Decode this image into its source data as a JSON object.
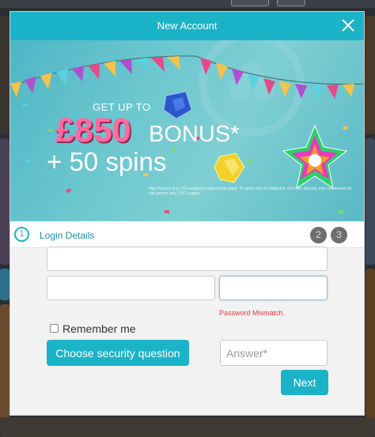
{
  "modal": {
    "title": "New Account",
    "close_icon": "close-icon"
  },
  "banner": {
    "line1": "GET UP TO",
    "amount": "£850",
    "bonus": "BONUS*",
    "spins": "+ 50 spins",
    "small_print": "New Players only. 50x wagering requirement apply. 50 spins only on Starburst. £10 min. deposit, max conversion 4x, slot games only. T&C's apply."
  },
  "steps": {
    "current_number": "1",
    "current_label": "Login Details",
    "step2": "2",
    "step3": "3"
  },
  "form": {
    "field1_value": "",
    "field2_value": "",
    "field3_value": "",
    "error_text": "Password Mismatch.",
    "remember_label": "Remember me",
    "remember_checked": false,
    "security_button": "Choose security question",
    "answer_placeholder": "Answer*",
    "answer_value": "",
    "next_button": "Next"
  },
  "colors": {
    "accent": "#1bb3c7",
    "error": "#e03a3a",
    "bonus_pink": "#ff6a9e"
  }
}
